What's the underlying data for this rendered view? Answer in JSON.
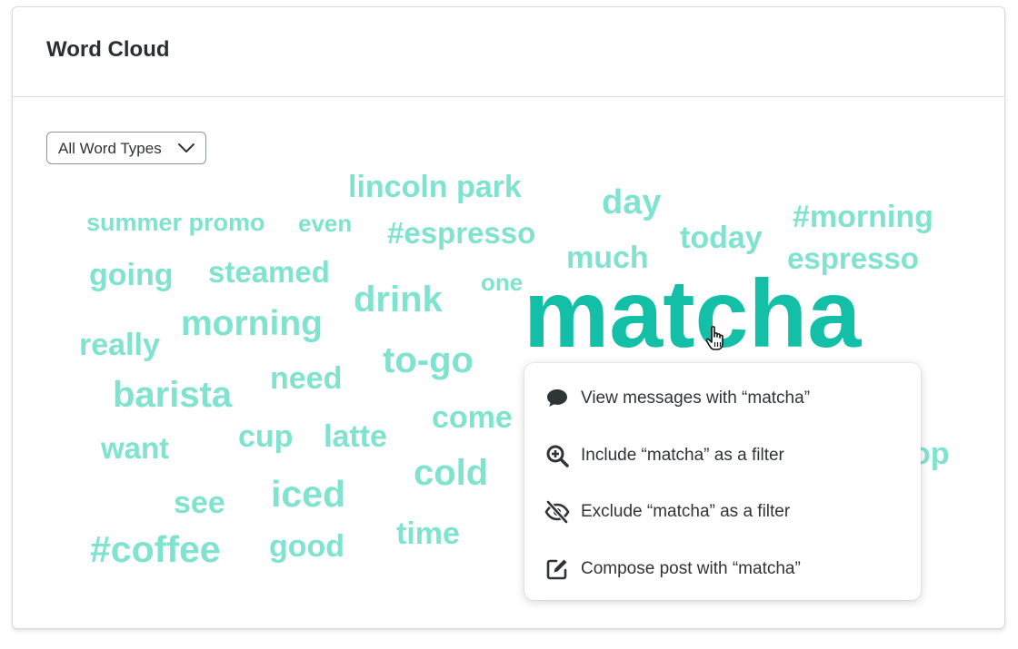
{
  "card": {
    "title": "Word Cloud"
  },
  "filter": {
    "selected": "All Word Types"
  },
  "words": [
    {
      "text": "lincoln park"
    },
    {
      "text": "day"
    },
    {
      "text": "summer promo"
    },
    {
      "text": "even"
    },
    {
      "text": "#espresso"
    },
    {
      "text": "today"
    },
    {
      "text": "#morning"
    },
    {
      "text": "much"
    },
    {
      "text": "espresso"
    },
    {
      "text": "going"
    },
    {
      "text": "steamed"
    },
    {
      "text": "one"
    },
    {
      "text": "drink"
    },
    {
      "text": "matcha"
    },
    {
      "text": "morning"
    },
    {
      "text": "really"
    },
    {
      "text": "to-go"
    },
    {
      "text": "need"
    },
    {
      "text": "barista"
    },
    {
      "text": "come"
    },
    {
      "text": "cup"
    },
    {
      "text": "latte"
    },
    {
      "text": "want"
    },
    {
      "text": "cold"
    },
    {
      "text": "iced"
    },
    {
      "text": "see"
    },
    {
      "text": "time"
    },
    {
      "text": "#coffee"
    },
    {
      "text": "good"
    },
    {
      "text": "op"
    }
  ],
  "context_menu": {
    "items": [
      {
        "label": "View messages with “matcha”",
        "icon": "chat-bubble-icon"
      },
      {
        "label": "Include “matcha” as a filter",
        "icon": "zoom-in-icon"
      },
      {
        "label": "Exclude “matcha” as a filter",
        "icon": "eye-slash-icon"
      },
      {
        "label": "Compose post with “matcha”",
        "icon": "compose-icon"
      }
    ]
  },
  "colors": {
    "word": "#7fe3cf",
    "word_selected": "#13bfa6",
    "text": "#2f3437"
  }
}
